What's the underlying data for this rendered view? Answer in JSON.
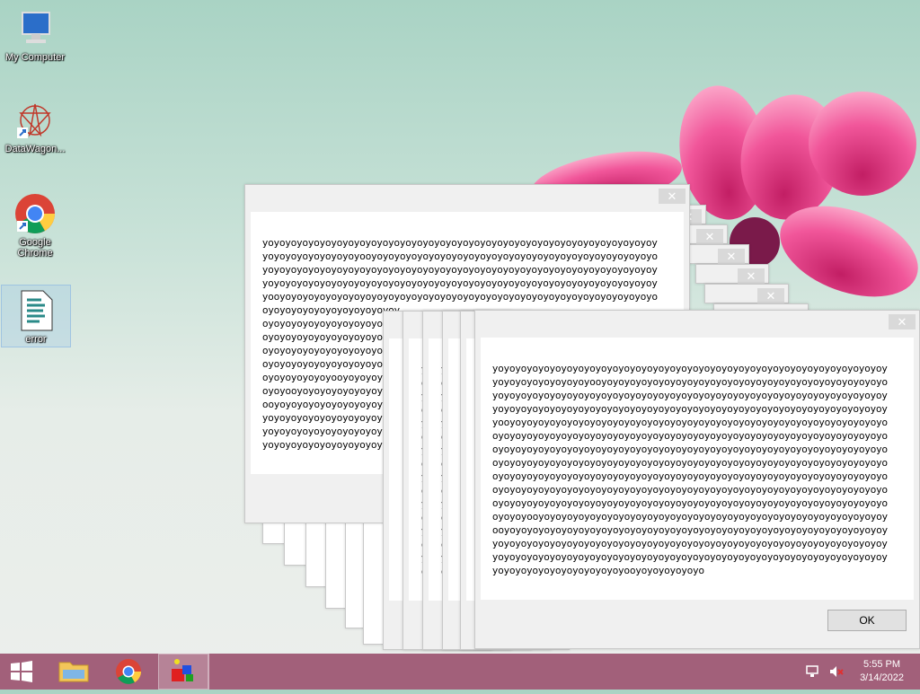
{
  "desktop": {
    "icons": [
      {
        "label": "My Computer"
      },
      {
        "label": "DataWagon..."
      },
      {
        "label": "Google Chrome",
        "line1": "Google",
        "line2": "Chrome"
      },
      {
        "label": "error"
      }
    ]
  },
  "dialog_back": {
    "close_symbol": "✕",
    "lines": [
      "yoyoyoyoyoyoyoyoyoyoyoyoyoyoyoyoyoyoyoyoyoyoyoyoyoyoyoyoyoyoyoyoyoyoyo",
      "yoyoyoyoyoyoyoyoyooyoyoyoyoyoyoyoyoyoyoyoyoyoyoyoyoyoyoyoyoyoyoyoyoyoyo",
      "yoyoyoyoyoyoyoyoyoyoyoyoyoyoyoyoyoyoyoyoyoyoyoyoyoyoyoyoyoyoyoyoyoyoyo",
      "yoyoyoyoyoyoyoyoyoyoyoyoyoyoyoyoyoyoyoyoyoyoyoyoyoyoyoyoyoyoyoyoyoyoyo",
      "yooyoyoyoyoyoyoyoyoyoyoyoyoyoyoyoyoyoyoyoyoyoyoyoyoyoyoyoyoyoyoyoyoyoy",
      "oyoyoyoyoyoyoyoyoyoyoyoy",
      "oyoyoyoyoyoyoyoyoyoyoyoy",
      "oyoyoyoyoyoyoyoyoyoyoyoy",
      "oyoyoyoyoyoyoyoyoyoyooyo",
      "oyoyoyoyoyoyoyoyoyoyoyoy",
      "oyoyoyoyoyoyooyoyoyoyoyo",
      "oyoyooyoyoyoyoyoyoyoyoyo",
      "ooyoyoyoyoyoyoyoyoyoyoyo",
      "yoyoyoyoyoyoyoyoyoyoyoyo",
      "yoyoyoyoyoyoyoyoyoyoyoyo",
      "yoyoyoyoyoyoyoyoyoyoyoyoo"
    ]
  },
  "dialog_front": {
    "close_symbol": "✕",
    "ok_label": "OK",
    "lines": [
      "yoyoyoyoyoyoyoyoyoyoyoyoyoyoyoyoyoyoyoyoyoyoyoyoyoyoyoyoyoyoyoyoyoyoyo",
      "yoyoyoyoyoyoyoyoyooyoyoyoyoyoyoyoyoyoyoyoyoyoyoyoyoyoyoyoyoyoyoyoyoyoyo",
      "yoyoyoyoyoyoyoyoyoyoyoyoyoyoyoyoyoyoyoyoyoyoyoyoyoyoyoyoyoyoyoyoyoyoyo",
      "yoyoyoyoyoyoyoyoyoyoyoyoyoyoyoyoyoyoyoyoyoyoyoyoyoyoyoyoyoyoyoyoyoyoyo",
      "yooyoyoyoyoyoyoyoyoyoyoyoyoyoyoyoyoyoyoyoyoyoyoyoyoyoyoyoyoyoyoyoyoyoy",
      "oyoyoyoyoyoyoyoyoyoyoyoyoyoyoyoyoyoyoyoyoyoyoyoyoyoyoyoyoyoyoyoyoyoyoy",
      "oyoyoyoyoyoyoyoyoyoyoyoyoyoyoyoyoyoyoyoyoyoyoyoyoyoyoyoyoyoyoyoyoyoyoy",
      "oyoyoyoyoyoyoyoyoyoyoyoyoyoyoyoyoyoyoyoyoyoyoyoyoyoyoyoyoyoyoyoyoyoyoy",
      "oyoyoyoyoyoyoyoyoyoyoyoyoyoyoyoyoyoyoyoyoyoyoyoyoyoyoyoyoyoyoyoyoyoyoy",
      "oyoyoyoyoyoyoyoyoyoyoyoyoyoyoyoyoyoyoyoyoyoyoyoyoyoyoyoyoyoyoyoyoyoyoy",
      "oyoyoyoyoyoyoyoyoyoyoyoyoyoyoyoyoyoyoyoyoyoyoyoyoyoyoyoyoyoyoyoyoyoyoy",
      "oyoyoyooyoyoyoyoyoyoyoyoyoyoyoyoyoyoyoyoyoyoyoyoyoyoyoyoyoyoyoyoyoyoyo",
      "ooyoyoyoyoyoyoyoyoyoyoyoyoyoyoyoyoyoyoyoyoyoyoyoyoyoyoyoyoyoyoyoyoyoyo",
      "yoyoyoyoyoyoyoyoyoyoyoyoyoyoyoyoyoyoyoyoyoyoyoyoyoyoyoyoyoyoyoyoyoyoyo",
      "yoyoyoyoyoyoyoyoyoyoyoyoyoyoyoyoyoyoyoyoyoyoyoyoyoyoyoyoyoyoyoyoyoyoyo",
      "yoyoyoyoyoyoyoyoyoyoyoyooyoyoyoyoyoyo"
    ]
  },
  "taskbar": {
    "clock_time": "5:55 PM",
    "clock_date": "3/14/2022",
    "colors": {
      "background": "#a2607a"
    }
  }
}
